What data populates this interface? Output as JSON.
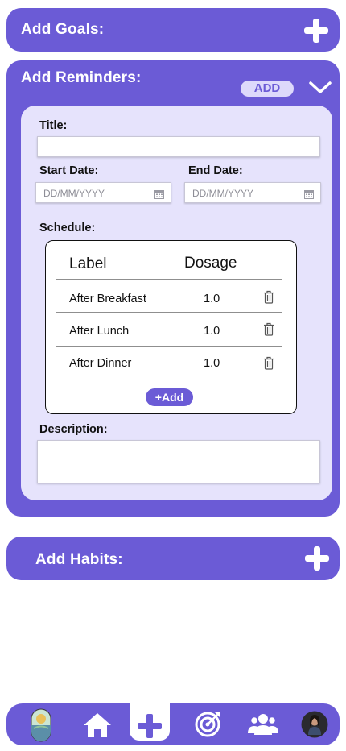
{
  "goals": {
    "title": "Add Goals:"
  },
  "reminders": {
    "title": "Add Reminders:",
    "add_label": "ADD",
    "form": {
      "title_label": "Title:",
      "title_value": "",
      "start_label": "Start Date:",
      "start_placeholder": "DD/MM/YYYY",
      "end_label": "End Date:",
      "end_placeholder": "DD/MM/YYYY",
      "schedule_label": "Schedule:",
      "schedule": {
        "headers": [
          "Label",
          "Dosage"
        ],
        "rows": [
          {
            "label": "After Breakfast",
            "dosage": "1.0"
          },
          {
            "label": "After Lunch",
            "dosage": "1.0"
          },
          {
            "label": "After Dinner",
            "dosage": "1.0"
          }
        ],
        "add_label": "Add"
      },
      "description_label": "Description:",
      "description_value": ""
    }
  },
  "habits": {
    "title": "Add Habits:"
  },
  "colors": {
    "accent": "#6b5bd6",
    "panel": "#e6e3fc",
    "pill": "#ddd9fb"
  },
  "nav": {
    "items": [
      "pill-icon",
      "home-icon",
      "add-icon",
      "target-icon",
      "community-icon",
      "profile-avatar"
    ],
    "active": "add-icon"
  }
}
